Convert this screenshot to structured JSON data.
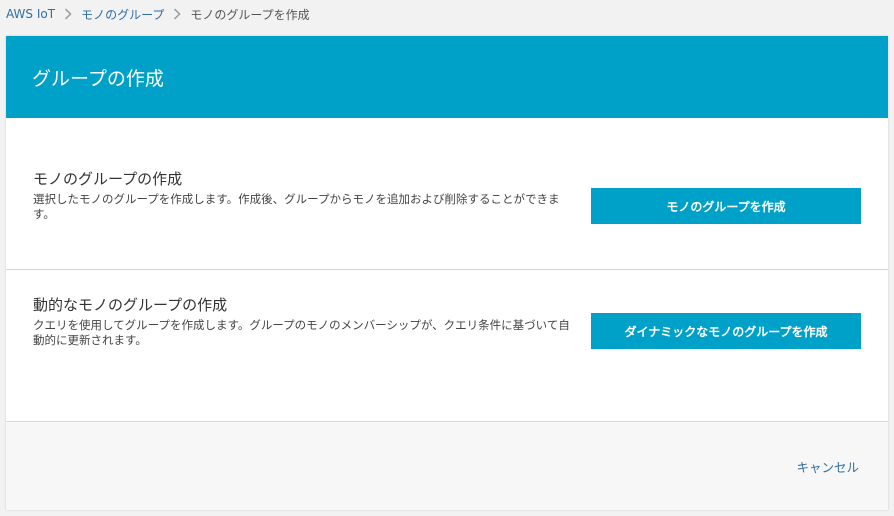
{
  "theme": {
    "accent": "#00a1c9",
    "link": "#2f6fa3"
  },
  "breadcrumb": {
    "items": [
      {
        "label": "AWS IoT"
      },
      {
        "label": "モノのグループ"
      },
      {
        "label": "モノのグループを作成"
      }
    ],
    "separator_icon": "chevron-right-icon"
  },
  "card": {
    "title": "グループの作成"
  },
  "sections": [
    {
      "title": "モノのグループの作成",
      "description": "選択したモノのグループを作成します。作成後、グループからモノを追加および削除することができます。",
      "button_label": "モノのグループを作成"
    },
    {
      "title": "動的なモノのグループの作成",
      "description": "クエリを使用してグループを作成します。グループのモノのメンバーシップが、クエリ条件に基づいて自動的に更新されます。",
      "button_label": "ダイナミックなモノのグループを作成"
    }
  ],
  "footer": {
    "cancel_label": "キャンセル"
  }
}
